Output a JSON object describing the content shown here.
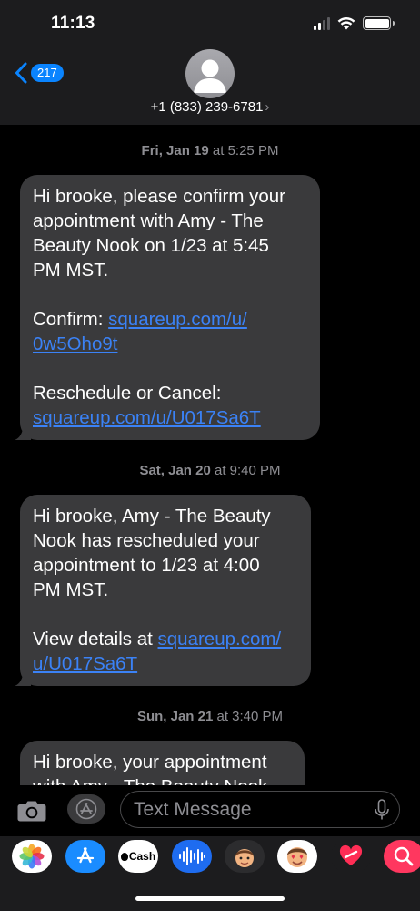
{
  "status": {
    "time": "11:13"
  },
  "header": {
    "back_count": "217",
    "contact": "+1 (833) 239-6781"
  },
  "messages": [
    {
      "day": "Fri, Jan 19",
      "time": "at 5:25 PM",
      "lines": [
        "Hi brooke, please confirm your",
        "appointment with Amy - The",
        "Beauty Nook on 1/23 at 5:45",
        "PM MST."
      ],
      "confirm_label": "Confirm: ",
      "confirm_link_1": "squareup.com/u/",
      "confirm_link_2": "0w5Oho9t",
      "resched_label": "Reschedule or Cancel:",
      "resched_link": "squareup.com/u/U017Sa6T"
    },
    {
      "day": "Sat, Jan 20",
      "time": "at 9:40 PM",
      "lines": [
        "Hi brooke, Amy - The Beauty",
        "Nook has rescheduled your",
        "appointment to 1/23 at 4:00",
        "PM MST."
      ],
      "view_label": "View details at ",
      "view_link_1": "squareup.com/",
      "view_link_2": "u/U017Sa6T"
    },
    {
      "day": "Sun, Jan 21",
      "time": "at 3:40 PM",
      "lines": [
        "Hi brooke, your appointment",
        "with Amy - The Beauty Nook"
      ]
    }
  ],
  "input": {
    "placeholder": "Text Message"
  },
  "apps": [
    {
      "name": "photos-app-icon"
    },
    {
      "name": "app-store-app-icon"
    },
    {
      "name": "apple-cash-app-icon",
      "label": "Cash"
    },
    {
      "name": "audio-message-app-icon"
    },
    {
      "name": "memoji-app-icon"
    },
    {
      "name": "memoji-stickers-app-icon"
    },
    {
      "name": "digital-touch-app-icon"
    },
    {
      "name": "images-search-app-icon"
    }
  ],
  "colors": {
    "bubble": "#3a3a3c",
    "link": "#3b82f6",
    "accent": "#0a84ff",
    "header": "#1c1c1e"
  }
}
